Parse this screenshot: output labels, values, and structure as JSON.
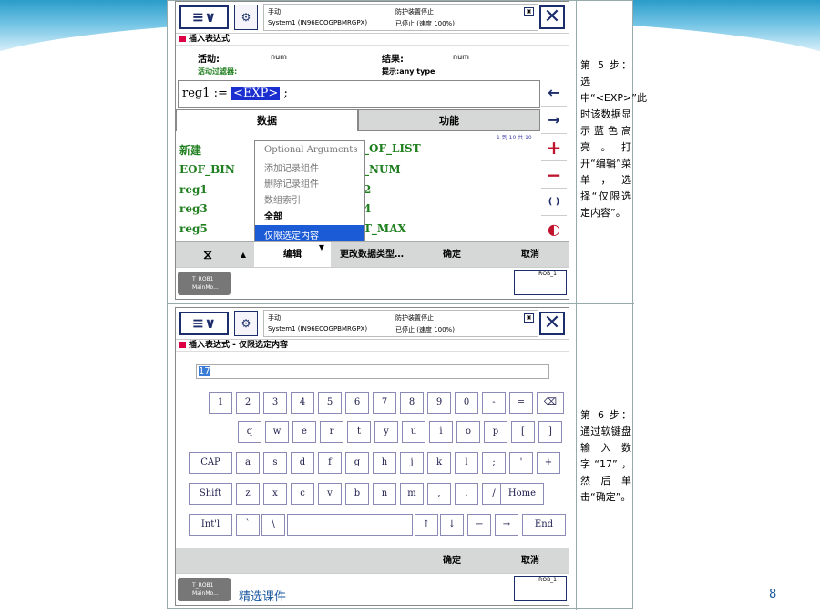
{
  "panel1": {
    "status": {
      "mode": "手动",
      "system": "System1 (IN96ECOGPBMRGPX)",
      "guard": "防护装置停止",
      "state": "已停止 (速度 100%)"
    },
    "title": "插入表达式",
    "active_label": "活动:",
    "active_value": "num",
    "result_label": "结果:",
    "result_value": "num",
    "filter_label": "活动过滤器:",
    "hint": "提示:any type",
    "expr_prefix": "reg1 :=",
    "expr_highlight": "<EXP>",
    "expr_suffix": ";",
    "tabs": [
      "数据",
      "功能"
    ],
    "paging": "1 到 10 共 10",
    "left_items": [
      "新建",
      "EOF_BIN",
      "reg1",
      "reg3",
      "reg5"
    ],
    "right_items": [
      "_OF_LIST",
      "_NUM",
      "2",
      "4",
      "T_MAX"
    ],
    "popup_items": [
      "Optional Arguments",
      "添加记录组件",
      "删除记录组件",
      "数组索引",
      "全部",
      "仅限选定内容"
    ],
    "side_buttons": [
      "←",
      "→",
      "+",
      "−",
      "( )",
      "◐"
    ],
    "toolbar": {
      "edit": "编辑",
      "change_type": "更改数据类型…",
      "ok": "确定",
      "cancel": "取消"
    },
    "task": {
      "line1": "T_ROB1",
      "line2": "MainMo..."
    },
    "robot": "ROB_1"
  },
  "panel2": {
    "status": {
      "mode": "手动",
      "system": "System1 (IN96ECOGPBMRGPX)",
      "guard": "防护装置停止",
      "state": "已停止 (速度 100%)"
    },
    "title": "插入表达式 - 仅限选定内容",
    "input_value": "17",
    "row1": [
      "1",
      "2",
      "3",
      "4",
      "5",
      "6",
      "7",
      "8",
      "9",
      "0",
      "-",
      "="
    ],
    "row2": [
      "q",
      "w",
      "e",
      "r",
      "t",
      "y",
      "u",
      "i",
      "o",
      "p",
      "[",
      "]"
    ],
    "row3": [
      "CAP",
      "a",
      "s",
      "d",
      "f",
      "g",
      "h",
      "j",
      "k",
      "l",
      ";",
      "'",
      "+"
    ],
    "row4": [
      "Shift",
      "z",
      "x",
      "c",
      "v",
      "b",
      "n",
      "m",
      ",",
      ".",
      "/",
      "Home"
    ],
    "row5": [
      "Int'l",
      "`",
      "\\",
      "",
      "↑",
      "↓",
      "←",
      "→",
      "End"
    ],
    "backspace": "⌫",
    "toolbar": {
      "ok": "确定",
      "cancel": "取消"
    },
    "task": {
      "line1": "T_ROB1",
      "line2": "MainMo..."
    },
    "robot": "ROB_1"
  },
  "step5": "第 5 步：选中“<EXP>”此时该数据显示蓝色高亮。打开“编辑”菜单，选择“仅限选定内容”。",
  "step6": "第 6 步：通过软键盘输入数字“17”，然后单击“确定”。",
  "footer": "精选课件",
  "page_number": "8"
}
